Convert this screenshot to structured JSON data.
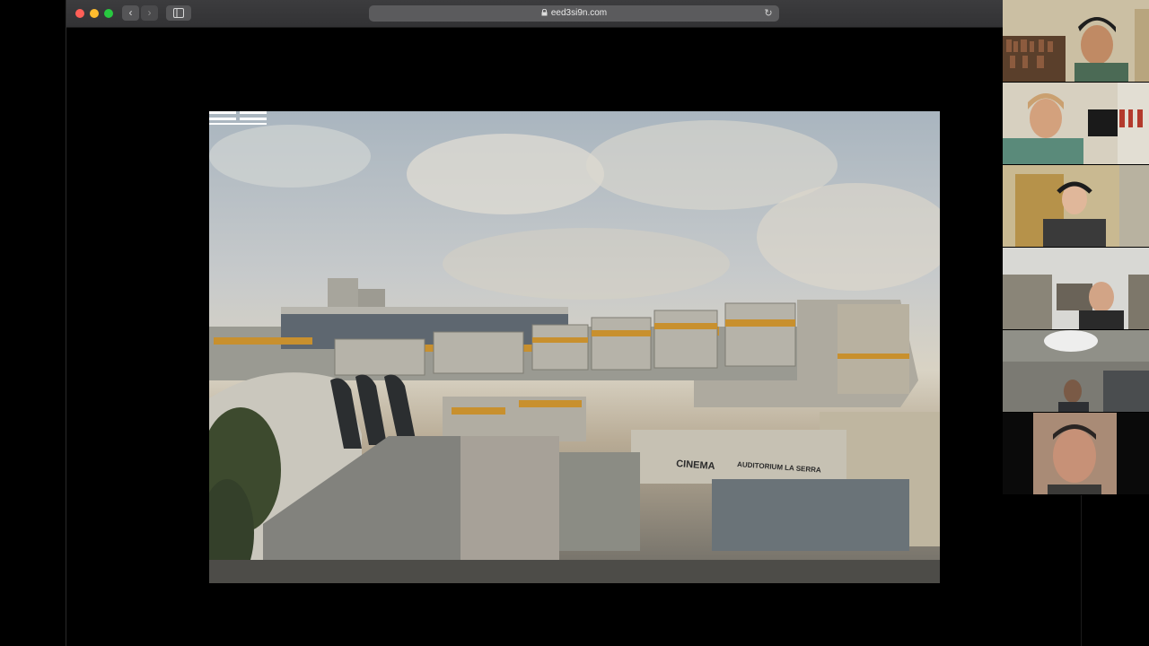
{
  "browser": {
    "url": "eed3si9n.com",
    "buttons": {
      "back": "‹",
      "forward": "›",
      "reload": "↻",
      "lock": "🔒"
    },
    "icons": {
      "lock": "lock-icon",
      "reload": "reload-icon",
      "sidebar": "sidebar-icon"
    }
  },
  "slide": {
    "signs": {
      "cinema": "CINEMA",
      "auditorium": "AUDITORIUM LA SERRA"
    }
  },
  "participants": [
    {
      "id": "participant-1"
    },
    {
      "id": "participant-2"
    },
    {
      "id": "participant-3"
    },
    {
      "id": "participant-4"
    },
    {
      "id": "participant-5"
    },
    {
      "id": "participant-6"
    }
  ],
  "colors": {
    "close": "#ff5f57",
    "minimize": "#febc2e",
    "maximize": "#28c840",
    "accent_orange": "#c8902e"
  }
}
